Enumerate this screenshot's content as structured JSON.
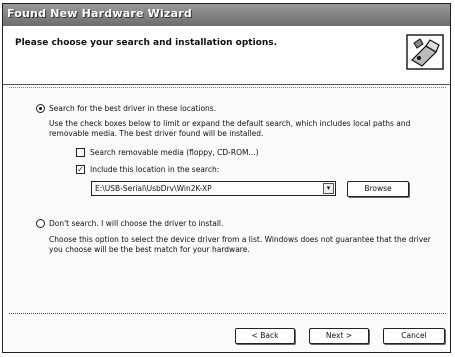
{
  "window": {
    "title": "Found New Hardware Wizard"
  },
  "header": {
    "title": "Please choose your search and installation options."
  },
  "options": {
    "search": {
      "label": "Search for the best driver in these locations.",
      "description": "Use the check boxes below to limit or expand the default search, which includes local paths and removable media. The best driver found will be installed.",
      "selected": true,
      "removable_media_label": "Search removable media (floppy, CD-ROM...)",
      "removable_media_checked": false,
      "include_location_label": "Include this location in the search:",
      "include_location_checked": true,
      "location_value": "E:\\USB-Serial\\UsbDrv\\Win2K-XP",
      "browse_label": "Browse"
    },
    "manual": {
      "label": "Don't search. I will choose the driver to install.",
      "description": "Choose this option to select the device driver from a list. Windows does not guarantee that the driver you choose will be the best match for your hardware.",
      "selected": false
    }
  },
  "footer": {
    "back_label": "< Back",
    "next_label": "Next >",
    "cancel_label": "Cancel"
  }
}
